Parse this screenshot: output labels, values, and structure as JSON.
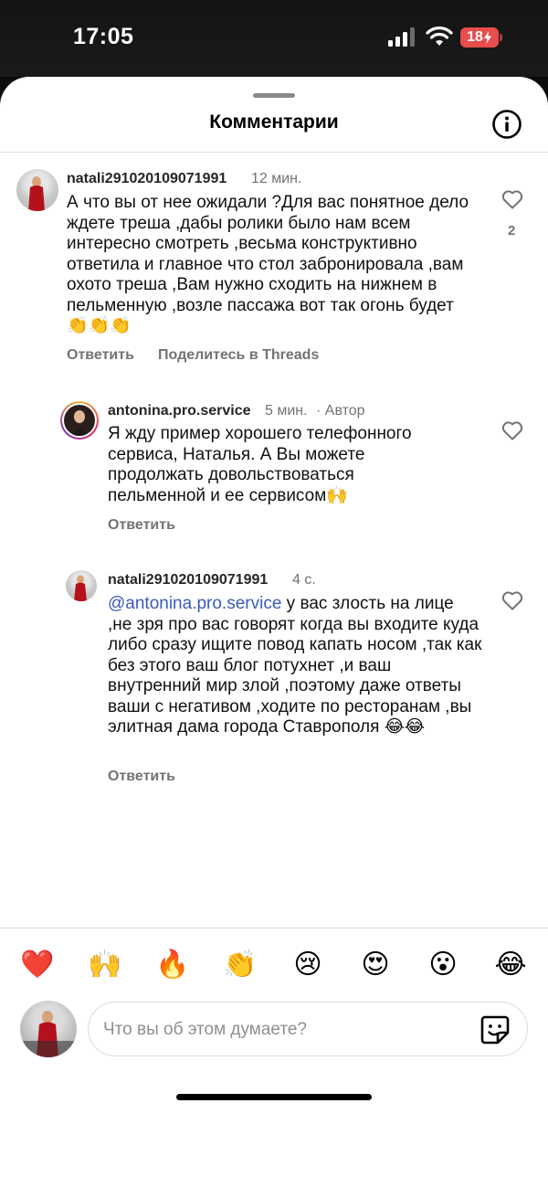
{
  "status_bar": {
    "time": "17:05",
    "battery": "18"
  },
  "sheet": {
    "title": "Комментарии"
  },
  "comments": [
    {
      "username": "natali291020109071991",
      "time": "12 мин.",
      "text": "А что вы от нее ожидали ?Для вас понятное дело ждете треша ,дабы ролики было нам всем интересно смотреть ,весьма конструктивно ответила и главное что стол забронировала ,вам охото треша ,Вам нужно сходить на нижнем в пельменную ,возле пассажа вот так огонь будет 👏👏👏",
      "like_count": "2",
      "reply_label": "Ответить",
      "share_label": "Поделитесь в Threads"
    },
    {
      "username": "antonina.pro.service",
      "time": "5 мин.",
      "author_badge": "· Автор",
      "text": "Я жду пример хорошего телефонного сервиса, Наталья. А Вы можете продолжать довольствоваться пельменной и ее сервисом🙌",
      "reply_label": "Ответить"
    },
    {
      "username": "natali291020109071991",
      "time": "4 с.",
      "mention": "@antonina.pro.service",
      "text": " у вас злость на лице ,не зря про вас говорят когда вы входите куда либо  сразу ищите повод капать носом ,так как без этого ваш блог потухнет ,и ваш внутренний мир злой ,поэтому даже ответы ваши с негативом ,ходите по ресторанам ,вы элитная дама города Ставрополя 😂😂",
      "reply_label": "Ответить"
    }
  ],
  "reactions": [
    "❤️",
    "🙌",
    "🔥",
    "👏",
    "😢",
    "😍",
    "😮",
    "😂"
  ],
  "input": {
    "placeholder": "Что вы об этом думаете?"
  },
  "colors": {
    "mention": "#3b5bb8",
    "battery": "#e84d4d",
    "heart_reaction": "#e0273b"
  }
}
